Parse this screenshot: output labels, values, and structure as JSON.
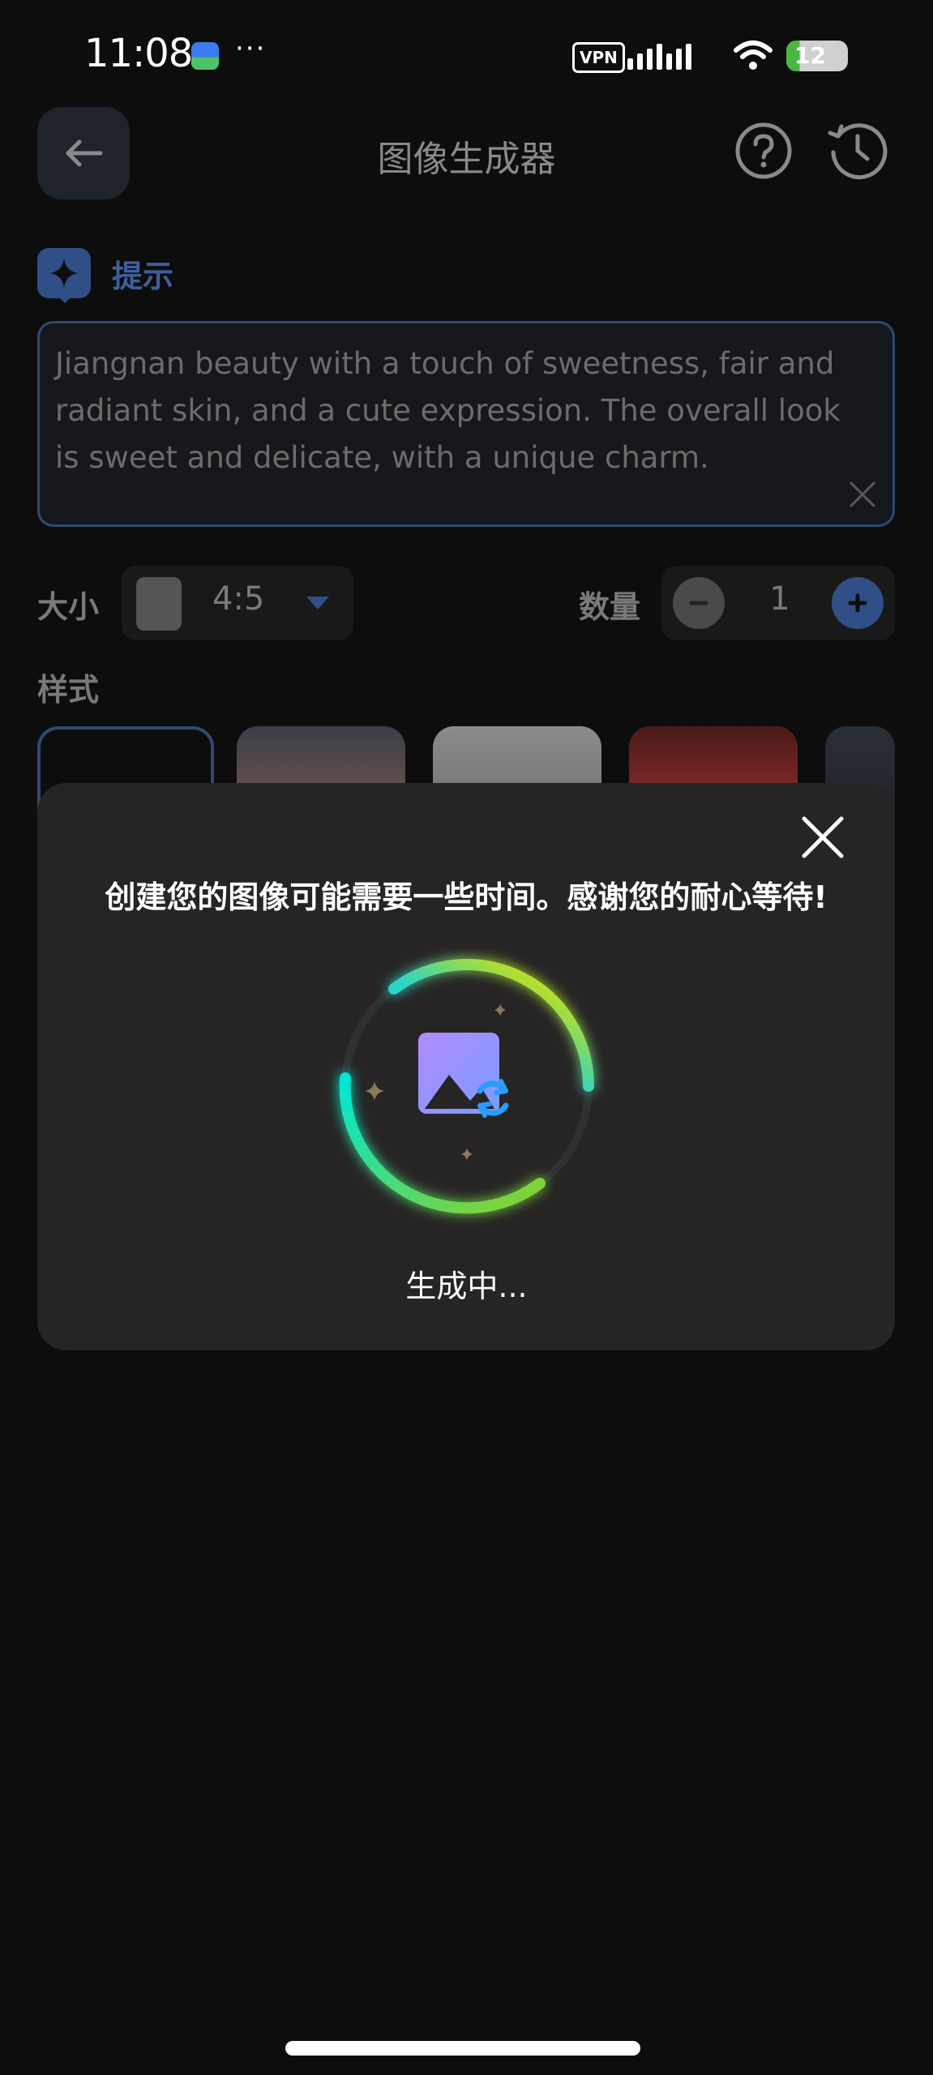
{
  "status_bar": {
    "time": "11:08",
    "dots": "···",
    "vpn": "VPN",
    "battery": "12"
  },
  "header": {
    "title": "图像生成器"
  },
  "prompt": {
    "label": "提示",
    "text": "Jiangnan beauty with a touch of sweetness, fair and radiant skin, and a cute expression. The overall look is sweet and delicate, with a unique charm."
  },
  "size": {
    "label": "大小",
    "value": "4:5"
  },
  "quantity": {
    "label": "数量",
    "value": "1"
  },
  "style": {
    "label": "样式"
  },
  "modal": {
    "message": "创建您的图像可能需要一些时间。感谢您的耐心等待!",
    "status": "生成中..."
  },
  "colors": {
    "accent": "#2f4f86",
    "background": "#0d0d0d",
    "modal_background": "#262424"
  }
}
